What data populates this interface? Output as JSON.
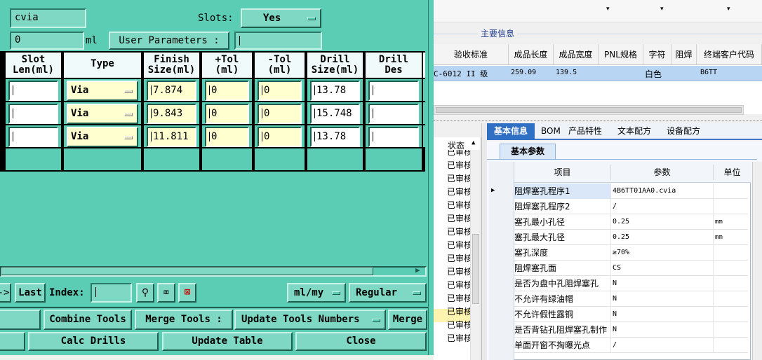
{
  "tool": {
    "filename": "cvia",
    "slots_label": "Slots:",
    "slots_value": "Yes",
    "depth_value": "0",
    "depth_unit": "ml",
    "user_params_label": "User Parameters :",
    "columns": [
      "Slot\nLen(ml)",
      "Type",
      "Finish\nSize(ml)",
      "+Tol\n(ml)",
      "-Tol\n(ml)",
      "Drill\nSize(ml)",
      "Drill\nDes"
    ],
    "rows": [
      {
        "slot_len": "",
        "type": "Via",
        "finish": "7.874",
        "ptol": "0",
        "mtol": "0",
        "drill": "13.78",
        "des": ""
      },
      {
        "slot_len": "",
        "type": "Via",
        "finish": "9.843",
        "ptol": "0",
        "mtol": "0",
        "drill": "15.748",
        "des": ""
      },
      {
        "slot_len": "",
        "type": "Via",
        "finish": "11.811",
        "ptol": "0",
        "mtol": "0",
        "drill": "13.78",
        "des": ""
      }
    ],
    "nav_arrow": "->",
    "last_label": "Last",
    "index_label": "Index:",
    "units_value": "ml/my",
    "mode_value": "Regular",
    "combine_tools": "Combine Tools",
    "merge_tools_label": "Merge Tools :",
    "merge_option": "Update Tools Numbers",
    "merge_button": "Merge",
    "calc_drills": "Calc Drills",
    "update_table": "Update Table",
    "close": "Close"
  },
  "main_info": {
    "group_title": "主要信息",
    "columns": [
      "验收标准",
      "成品长度",
      "成品宽度",
      "PNL规格",
      "字符",
      "阻焊",
      "终端客户代码"
    ],
    "row": [
      "C-6012 II 级",
      "259.09",
      "139.5",
      "",
      "",
      "白色",
      "B6TT"
    ]
  },
  "status_header": "状态",
  "status_items": [
    "已审核",
    "已审核",
    "已审核",
    "已审核",
    "已审核",
    "已审核",
    "已审核",
    "已审核",
    "已审核",
    "已审核",
    "已审核",
    "已审核",
    "已审核",
    "已审核",
    "已审核"
  ],
  "tabs": [
    "基本信息",
    "BOM",
    "产品特性",
    "文本配方",
    "设备配方"
  ],
  "subtab": "基本参数",
  "params": {
    "columns": [
      "项目",
      "参数",
      "单位"
    ],
    "rows": [
      {
        "item": "阻焊塞孔程序1",
        "value": "4B6TT01AA0.cvia",
        "unit": ""
      },
      {
        "item": "阻焊塞孔程序2",
        "value": "/",
        "unit": ""
      },
      {
        "item": "塞孔最小孔径",
        "value": "0.25",
        "unit": "mm"
      },
      {
        "item": "塞孔最大孔径",
        "value": "0.25",
        "unit": "mm"
      },
      {
        "item": "塞孔深度",
        "value": "≥70%",
        "unit": ""
      },
      {
        "item": "阻焊塞孔面",
        "value": "CS",
        "unit": ""
      },
      {
        "item": "是否为盘中孔阻焊塞孔",
        "value": "N",
        "unit": ""
      },
      {
        "item": "不允许有绿油帽",
        "value": "N",
        "unit": ""
      },
      {
        "item": "不允许假性露铜",
        "value": "N",
        "unit": ""
      },
      {
        "item": "是否背钻孔阻焊塞孔制作",
        "value": "N",
        "unit": ""
      },
      {
        "item": "单面开窗不掏曝光点",
        "value": "/",
        "unit": ""
      }
    ]
  }
}
